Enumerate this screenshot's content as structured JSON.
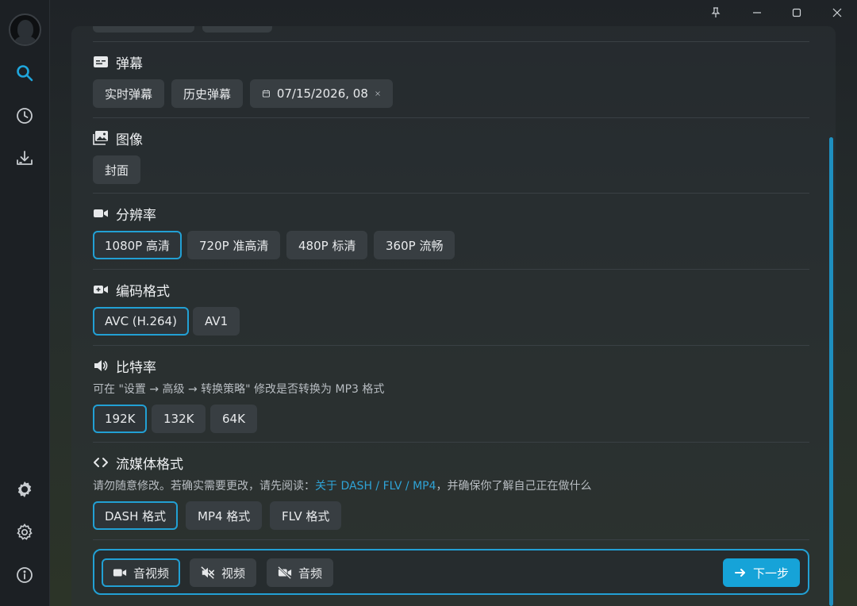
{
  "sidebar": {
    "items": [
      {
        "name": "search",
        "icon": "search-icon"
      },
      {
        "name": "history",
        "icon": "clock-icon"
      },
      {
        "name": "downloads",
        "icon": "download-icon"
      },
      {
        "name": "theme",
        "icon": "badge-gear-icon"
      },
      {
        "name": "settings",
        "icon": "gear-icon"
      },
      {
        "name": "about",
        "icon": "info-icon"
      }
    ],
    "active": "search"
  },
  "titlebar": {
    "pin": "pin-icon",
    "minimize": "minimize-icon",
    "maximize": "maximize-icon",
    "close": "close-icon"
  },
  "sections": {
    "danmaku": {
      "title": "弹幕",
      "options": [
        "实时弹幕",
        "历史弹幕"
      ],
      "date_value": "07/15/2026, 08"
    },
    "image": {
      "title": "图像",
      "options": [
        "封面"
      ]
    },
    "resolution": {
      "title": "分辨率",
      "options": [
        "1080P 高清",
        "720P 准高清",
        "480P 标清",
        "360P 流畅"
      ],
      "selected": "1080P 高清"
    },
    "codec": {
      "title": "编码格式",
      "options": [
        "AVC (H.264)",
        "AV1"
      ],
      "selected": "AVC (H.264)"
    },
    "bitrate": {
      "title": "比特率",
      "desc": "可在 \"设置 → 高级 → 转换策略\" 修改是否转换为 MP3 格式",
      "options": [
        "192K",
        "132K",
        "64K"
      ],
      "selected": "192K"
    },
    "stream": {
      "title": "流媒体格式",
      "desc_before": "请勿随意修改。若确实需要更改，请先阅读：",
      "desc_link": "关于 DASH / FLV / MP4",
      "desc_after": "，并确保你了解自己正在做什么",
      "options": [
        "DASH 格式",
        "MP4 格式",
        "FLV 格式"
      ],
      "selected": "DASH 格式"
    }
  },
  "bottom": {
    "modes": [
      "音视频",
      "视频",
      "音频"
    ],
    "selected": "音视频",
    "next_label": "下一步"
  },
  "colors": {
    "accent": "#22a0d4",
    "button": "#16a3d8"
  }
}
